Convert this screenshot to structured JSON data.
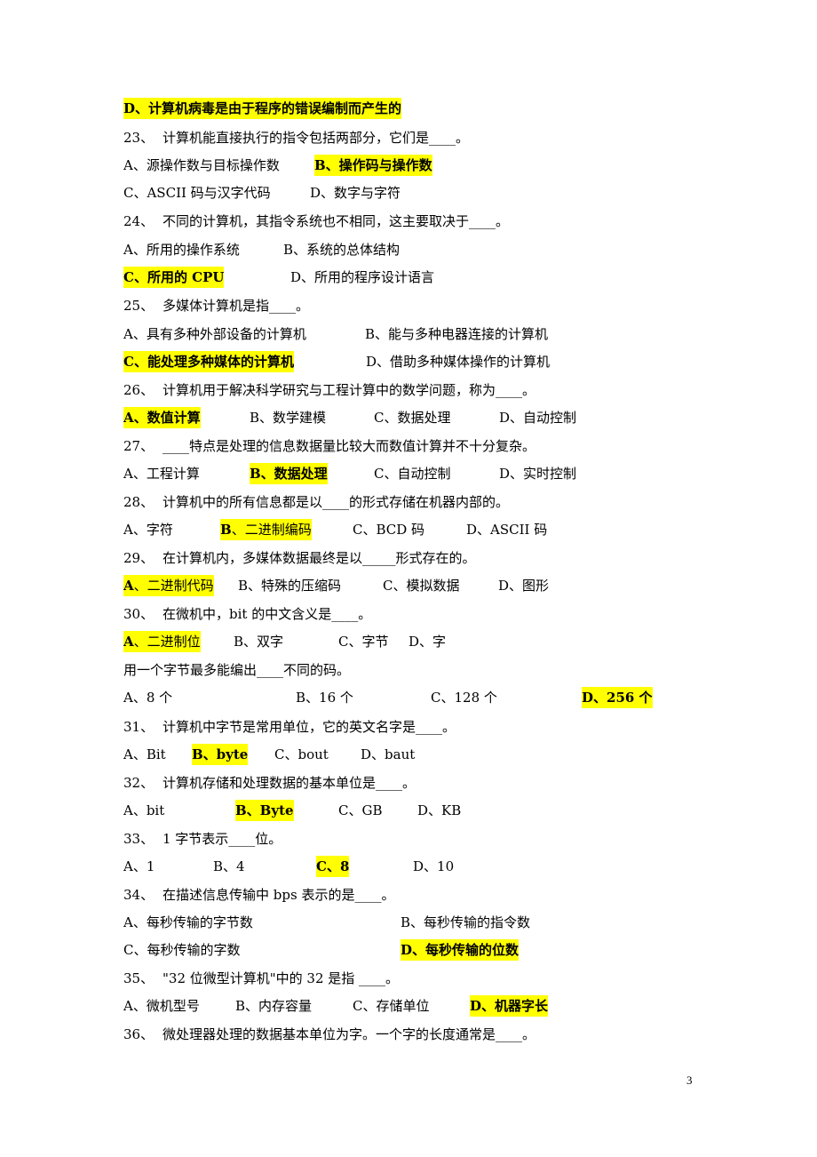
{
  "document": {
    "page_number": "3",
    "highlight_color": "#ffff00",
    "lines": [
      {
        "type": "answer",
        "options": [
          {
            "text": "D、计算机病毒是由于程序的错误编制而产生的",
            "highlight": true,
            "bold": true
          }
        ]
      },
      {
        "type": "question",
        "number": "23、",
        "text": "计算机能直接执行的指令包括两部分，它们是____。"
      },
      {
        "type": "options",
        "options": [
          {
            "text": "A、源操作数与目标操作数"
          },
          {
            "text": "B、操作码与操作数",
            "highlight": true,
            "bold": true
          }
        ]
      },
      {
        "type": "options",
        "options": [
          {
            "text": "C、ASCII 码与汉字代码"
          },
          {
            "text": "D、数字与字符"
          }
        ]
      },
      {
        "type": "question",
        "number": "24、",
        "text": "不同的计算机，其指令系统也不相同，这主要取决于____。"
      },
      {
        "type": "options",
        "options": [
          {
            "text": "A、所用的操作系统"
          },
          {
            "text": "B、系统的总体结构"
          }
        ]
      },
      {
        "type": "options",
        "options": [
          {
            "text": "C、所用的 CPU",
            "highlight": true,
            "bold": true
          },
          {
            "text": "D、所用的程序设计语言"
          }
        ]
      },
      {
        "type": "question",
        "number": "25、",
        "text": "多媒体计算机是指____。"
      },
      {
        "type": "options",
        "options": [
          {
            "text": "A、具有多种外部设备的计算机"
          },
          {
            "text": "B、能与多种电器连接的计算机"
          }
        ]
      },
      {
        "type": "options",
        "options": [
          {
            "text": "C、能处理多种媒体的计算机",
            "highlight": true,
            "bold": true
          },
          {
            "text": "D、借助多种媒体操作的计算机"
          }
        ]
      },
      {
        "type": "question",
        "number": "26、",
        "text": "计算机用于解决科学研究与工程计算中的数学问题，称为____。"
      },
      {
        "type": "options",
        "options": [
          {
            "text": "A、数值计算",
            "highlight": true,
            "bold": true
          },
          {
            "text": "B、数学建模"
          },
          {
            "text": "C、数据处理"
          },
          {
            "text": "D、自动控制"
          }
        ]
      },
      {
        "type": "question",
        "number": "27、",
        "text": "____特点是处理的信息数据量比较大而数值计算并不十分复杂。"
      },
      {
        "type": "options",
        "options": [
          {
            "text": "A、工程计算"
          },
          {
            "text": "B、数据处理",
            "highlight": true,
            "bold": true
          },
          {
            "text": "C、自动控制"
          },
          {
            "text": "D、实时控制"
          }
        ]
      },
      {
        "type": "question",
        "number": "28、",
        "text": "计算机中的所有信息都是以____的形式存储在机器内部的。"
      },
      {
        "type": "options",
        "options": [
          {
            "text": "A、字符"
          },
          {
            "text": "B、二进制编码",
            "highlight": true,
            "letter_bold": true
          },
          {
            "text": "C、BCD 码"
          },
          {
            "text": "D、ASCII 码"
          }
        ]
      },
      {
        "type": "question",
        "number": "29、",
        "text": "在计算机内，多媒体数据最终是以_____形式存在的。"
      },
      {
        "type": "options",
        "options": [
          {
            "text": "A、二进制代码",
            "highlight": true,
            "letter_bold": true
          },
          {
            "text": "B、特殊的压缩码"
          },
          {
            "text": "C、模拟数据"
          },
          {
            "text": "D、图形"
          }
        ]
      },
      {
        "type": "question",
        "number": "30、",
        "text": "在微机中，bit 的中文含义是____。"
      },
      {
        "type": "options",
        "options": [
          {
            "text": "A、二进制位",
            "highlight": true,
            "letter_bold": true
          },
          {
            "text": "B、双字"
          },
          {
            "text": "C、字节"
          },
          {
            "text": "D、字"
          }
        ]
      },
      {
        "type": "question",
        "number": "",
        "text": "用一个字节最多能编出____不同的码。"
      },
      {
        "type": "options",
        "options": [
          {
            "text": "A、8 个"
          },
          {
            "text": "B、16 个"
          },
          {
            "text": "C、128 个"
          },
          {
            "text": "D、256 个",
            "highlight": true,
            "bold": true
          }
        ]
      },
      {
        "type": "question",
        "number": "31、",
        "text": "计算机中字节是常用单位，它的英文名字是____。"
      },
      {
        "type": "options",
        "options": [
          {
            "text": " A、Bit"
          },
          {
            "text": "B、byte",
            "highlight": true,
            "bold": true
          },
          {
            "text": "C、bout"
          },
          {
            "text": "D、baut"
          }
        ]
      },
      {
        "type": "question",
        "number": "32、",
        "text": "计算机存储和处理数据的基本单位是____。"
      },
      {
        "type": "options",
        "options": [
          {
            "text": "A、bit"
          },
          {
            "text": "B、Byte",
            "highlight": true,
            "bold": true
          },
          {
            "text": "C、GB"
          },
          {
            "text": "D、KB"
          }
        ]
      },
      {
        "type": "question",
        "number": "33、",
        "text": "1 字节表示____位。"
      },
      {
        "type": "options",
        "options": [
          {
            "text": "A、1"
          },
          {
            "text": "B、4"
          },
          {
            "text": "C、8",
            "highlight": true,
            "bold": true
          },
          {
            "text": "D、10"
          }
        ]
      },
      {
        "type": "question",
        "number": "34、",
        "text": "在描述信息传输中 bps 表示的是____。"
      },
      {
        "type": "options",
        "options": [
          {
            "text": "A、每秒传输的字节数"
          },
          {
            "text": "B、每秒传输的指令数"
          }
        ]
      },
      {
        "type": "options",
        "options": [
          {
            "text": "C、每秒传输的字数"
          },
          {
            "text": "D、每秒传输的位数",
            "highlight": true,
            "bold": true
          }
        ]
      },
      {
        "type": "question",
        "number": "35、",
        "text": "\"32 位微型计算机\"中的 32 是指 ____。"
      },
      {
        "type": "options",
        "options": [
          {
            "text": "A、微机型号"
          },
          {
            "text": "B、内存容量"
          },
          {
            "text": "C、存储单位"
          },
          {
            "text": "D、机器字长",
            "highlight": true,
            "bold": true
          }
        ]
      },
      {
        "type": "question",
        "number": "36、",
        "text": "微处理器处理的数据基本单位为字。一个字的长度通常是____。"
      }
    ]
  }
}
